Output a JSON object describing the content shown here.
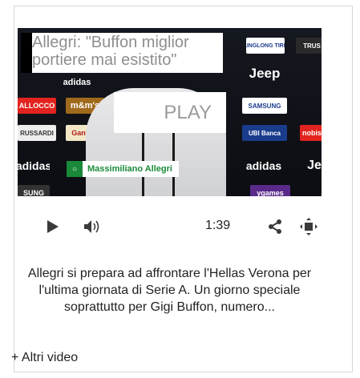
{
  "video": {
    "title": "Allegri: \"Buffon miglior portiere mai esistito\"",
    "play_label": "PLAY",
    "name_tag": "Massimiliano Allegri",
    "sponsors": [
      "LINGLONG TIRE",
      "TRUS",
      "Jeep",
      "adidas",
      "ALLOCCO",
      "m&m's",
      "SAMSUNG",
      "RUSSARDI",
      "Gantelo",
      "UBI Banca",
      "nobis",
      "adidas",
      "adidas",
      "SUNG",
      "Je",
      "ygames"
    ]
  },
  "controls": {
    "duration": "1:39",
    "play_icon": "play-icon",
    "volume_icon": "volume-icon",
    "share_icon": "share-icon",
    "fullscreen_icon": "fullscreen-icon"
  },
  "description": "Allegri si prepara ad affrontare l'Hellas Verona per l'ultima giornata di Serie A. Un giorno speciale soprattutto per Gigi Buffon, numero...",
  "more_videos": "+ Altri video",
  "colors": {
    "accent_green": "#1a8a3a",
    "text": "#222222",
    "border": "#d6d6d6"
  }
}
